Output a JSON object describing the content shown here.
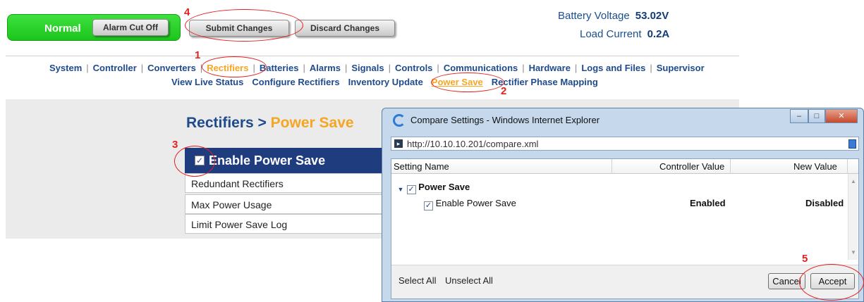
{
  "header": {
    "status": "Normal",
    "alarm_cut_off": "Alarm Cut Off",
    "submit_changes": "Submit Changes",
    "discard_changes": "Discard Changes",
    "battery_voltage_label": "Battery Voltage",
    "battery_voltage_value": "53.02V",
    "load_current_label": "Load Current",
    "load_current_value": "0.2A"
  },
  "nav": {
    "items": [
      "System",
      "Controller",
      "Converters",
      "Rectifiers",
      "Batteries",
      "Alarms",
      "Signals",
      "Controls",
      "Communications",
      "Hardware",
      "Logs and Files",
      "Supervisor"
    ],
    "active": "Rectifiers",
    "sub_items": [
      "View Live Status",
      "Configure Rectifiers",
      "Inventory Update",
      "Power Save",
      "Rectifier Phase Mapping"
    ],
    "sub_active": "Power Save"
  },
  "page": {
    "breadcrumb_parent": "Rectifiers >",
    "breadcrumb_current": "Power Save",
    "enable_label": "Enable Power Save",
    "rows": [
      "Redundant Rectifiers",
      "Max Power Usage",
      "Limit Power Save Log"
    ]
  },
  "dialog": {
    "title": "Compare Settings - Windows Internet Explorer",
    "url": "http://10.10.10.201/compare.xml",
    "columns": [
      "Setting Name",
      "Controller Value",
      "New Value"
    ],
    "group": "Power Save",
    "item": "Enable Power Save",
    "controller_value": "Enabled",
    "new_value": "Disabled",
    "select_all": "Select All",
    "unselect_all": "Unselect All",
    "cancel": "Cancel",
    "accept": "Accept"
  },
  "annotations": [
    "1",
    "2",
    "3",
    "4",
    "5"
  ]
}
